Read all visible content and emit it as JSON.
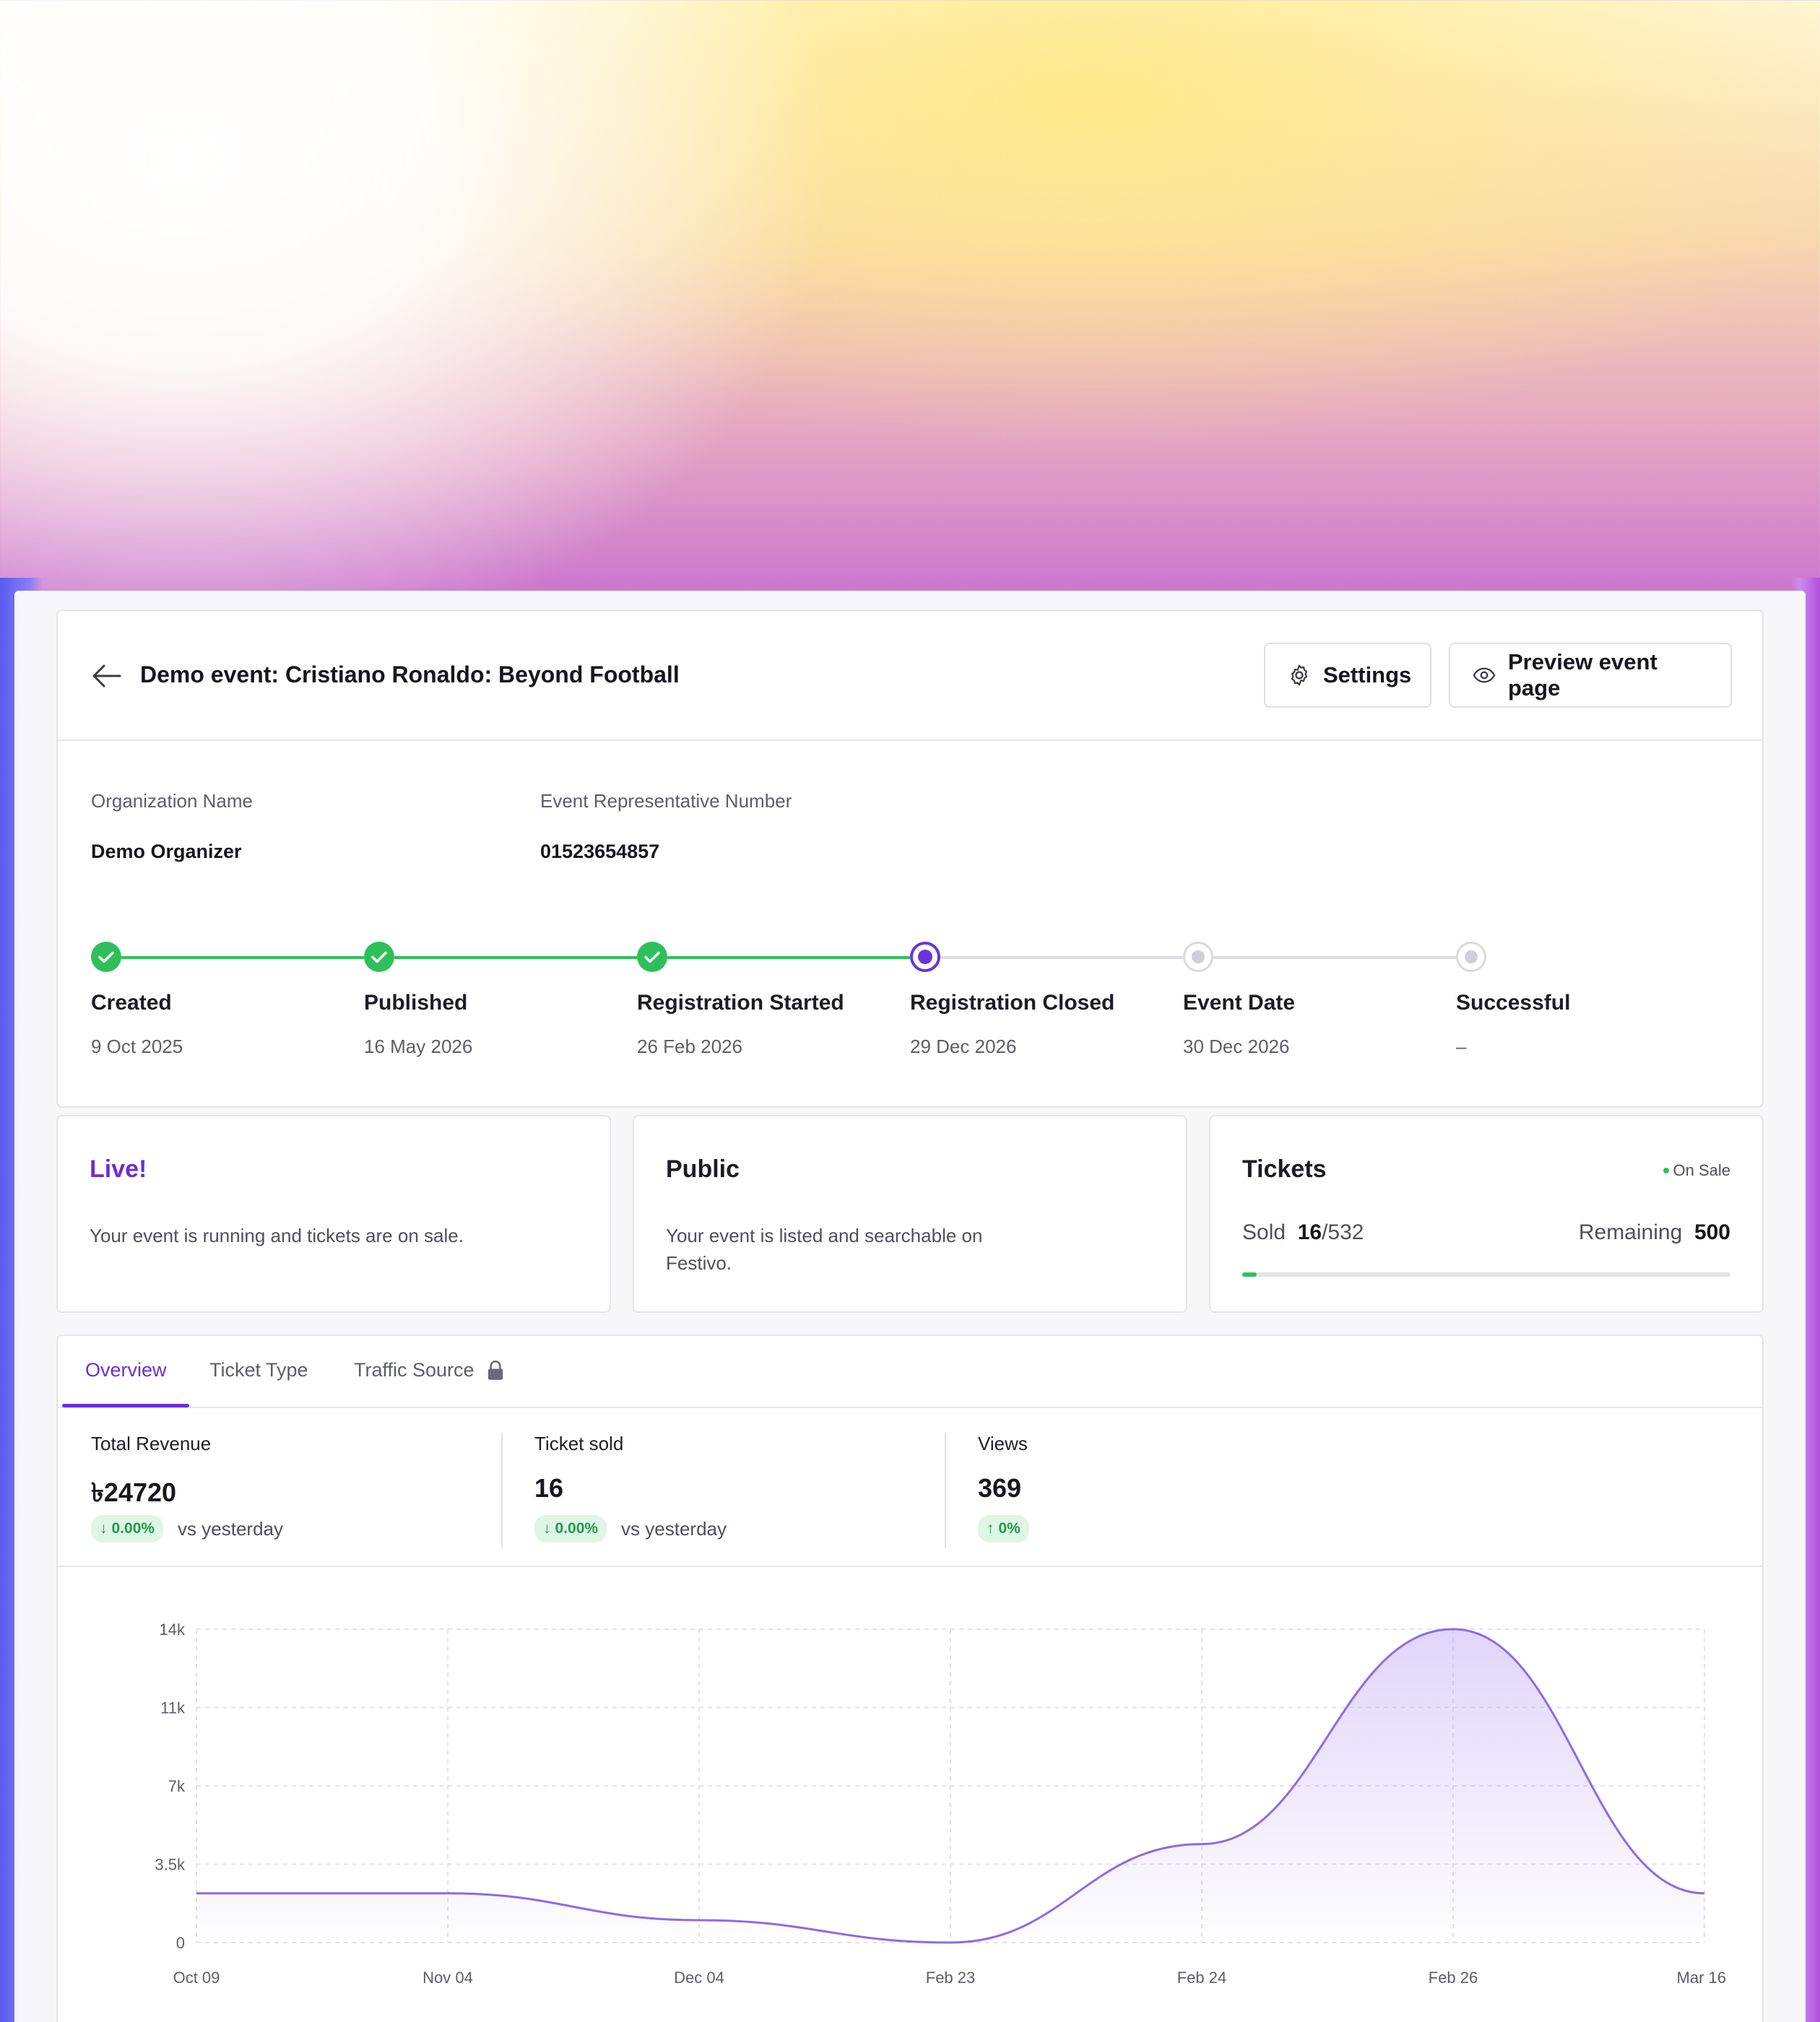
{
  "header": {
    "title": "Demo event: Cristiano Ronaldo: Beyond Football",
    "settings_label": "Settings",
    "preview_label": "Preview event page"
  },
  "info": {
    "org_label": "Organization Name",
    "org_value": "Demo Organizer",
    "rep_label": "Event Representative Number",
    "rep_value": "01523654857"
  },
  "steps": [
    {
      "name": "Created",
      "date": "9 Oct 2025",
      "state": "done"
    },
    {
      "name": "Published",
      "date": "16 May 2026",
      "state": "done"
    },
    {
      "name": "Registration Started",
      "date": "26 Feb 2026",
      "state": "done"
    },
    {
      "name": "Registration Closed",
      "date": "29 Dec 2026",
      "state": "current"
    },
    {
      "name": "Event Date",
      "date": "30 Dec 2026",
      "state": "future"
    },
    {
      "name": "Successful",
      "date": "–",
      "state": "future"
    }
  ],
  "status": {
    "live_title": "Live!",
    "live_desc": "Your event is running and tickets are on sale.",
    "public_title": "Public",
    "public_desc": "Your event is listed and searchable on Festivo."
  },
  "tickets": {
    "title": "Tickets",
    "badge": "On Sale",
    "sold_label": "Sold",
    "sold": "16",
    "total": "/532",
    "remaining_label": "Remaining",
    "remaining": "500",
    "sold_fraction": 0.03
  },
  "tabs": [
    {
      "label": "Overview",
      "active": true
    },
    {
      "label": "Ticket Type",
      "active": false
    },
    {
      "label": "Traffic Source",
      "active": false
    }
  ],
  "metrics": [
    {
      "label": "Total Revenue",
      "value": "৳24720",
      "delta": "0.00%",
      "direction": "down",
      "vs": "vs yesterday"
    },
    {
      "label": "Ticket sold",
      "value": "16",
      "delta": "0.00%",
      "direction": "down",
      "vs": "vs yesterday"
    },
    {
      "label": "Views",
      "value": "369",
      "delta": "0%",
      "direction": "up",
      "vs": ""
    }
  ],
  "colors": {
    "accent": "#6a2fd8",
    "success": "#2fbf5a",
    "line": "#8b6be8"
  },
  "chart_data": {
    "type": "area",
    "x": [
      "Oct 09",
      "Nov 04",
      "Dec 04",
      "Feb 23",
      "Feb 24",
      "Feb 26",
      "Mar 16"
    ],
    "values": [
      2200,
      2200,
      1000,
      0,
      4400,
      14000,
      2200
    ],
    "yticks": [
      "0",
      "3.5k",
      "7k",
      "11k",
      "14k"
    ],
    "ytick_values": [
      0,
      3500,
      7000,
      10500,
      14000
    ],
    "ylim": [
      0,
      14000
    ],
    "grid": true
  }
}
